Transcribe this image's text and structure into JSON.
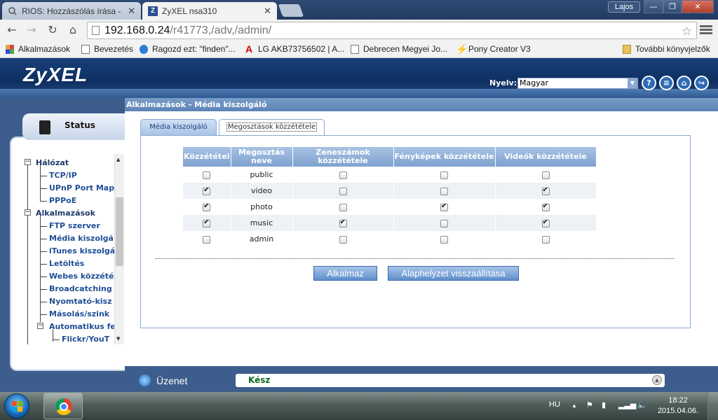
{
  "browser": {
    "tabs": [
      {
        "title": "RIOS: Hozzászólás írása - ",
        "active": false
      },
      {
        "title": "ZyXEL nsa310",
        "active": true
      }
    ],
    "user": "Lajos",
    "url_host": "192.168.0.24",
    "url_path": "/r41773,/adv,/admin/",
    "bookmarks": [
      "Alkalmazások",
      "Bevezetés",
      "Ragozd ezt: \"finden\"...",
      "LG AKB73756502 | A...",
      "Debrecen Megyei Jo...",
      "Pony Creator V3",
      "További könyvjelzők"
    ]
  },
  "app": {
    "logo": "ZyXEL",
    "language_label": "Nyelv:",
    "language_value": "Magyar",
    "header_icons": [
      "help-icon",
      "notes-icon",
      "home-icon",
      "logout-icon"
    ],
    "status_tab": "Status",
    "tree": [
      {
        "label": "Hálózat",
        "level": 0,
        "expander": "−"
      },
      {
        "label": "TCP/IP",
        "level": 1
      },
      {
        "label": "UPnP Port Map",
        "level": 1
      },
      {
        "label": "PPPoE",
        "level": 1
      },
      {
        "label": "Alkalmazások",
        "level": 0,
        "expander": "−"
      },
      {
        "label": "FTP szerver",
        "level": 1
      },
      {
        "label": "Média kiszolgá",
        "level": 1
      },
      {
        "label": "iTunes kiszolgá",
        "level": 1
      },
      {
        "label": "Letöltés",
        "level": 1
      },
      {
        "label": "Webes közzété",
        "level": 1
      },
      {
        "label": "Broadcatching",
        "level": 1
      },
      {
        "label": "Nyomtató-kisz",
        "level": 1
      },
      {
        "label": "Másolás/szink",
        "level": 1
      },
      {
        "label": "Automatikus fe",
        "level": 1,
        "expander": "−"
      },
      {
        "label": "Flickr/YouT",
        "level": 2
      }
    ],
    "page_title": "Alkalmazások - Média kiszolgáló",
    "tabs": [
      "Média kiszolgáló",
      "Megosztások közzététele"
    ],
    "active_tab": 1,
    "table": {
      "headers": [
        "Közzététel",
        "Megosztás neve",
        "Zeneszámok közzététele",
        "Fényképek közzététele",
        "Videók közzététele"
      ],
      "rows": [
        {
          "publish": false,
          "name": "public",
          "music": false,
          "photos": false,
          "videos": false
        },
        {
          "publish": true,
          "name": "video",
          "music": false,
          "photos": false,
          "videos": true
        },
        {
          "publish": true,
          "name": "photo",
          "music": false,
          "photos": true,
          "videos": true
        },
        {
          "publish": true,
          "name": "music",
          "music": true,
          "photos": false,
          "videos": true
        },
        {
          "publish": false,
          "name": "admin",
          "music": false,
          "photos": false,
          "videos": false
        }
      ]
    },
    "buttons": {
      "apply": "Alkalmaz",
      "reset": "Alaphelyzet visszaállítása"
    },
    "status": {
      "label": "Üzenet",
      "message": "Kész"
    }
  },
  "taskbar": {
    "language": "HU",
    "time": "18:22",
    "date": "2015.04.06."
  },
  "colors": {
    "header_bg": "#173f79",
    "accent": "#5c83b6",
    "status_ok": "#0a6b1e"
  }
}
